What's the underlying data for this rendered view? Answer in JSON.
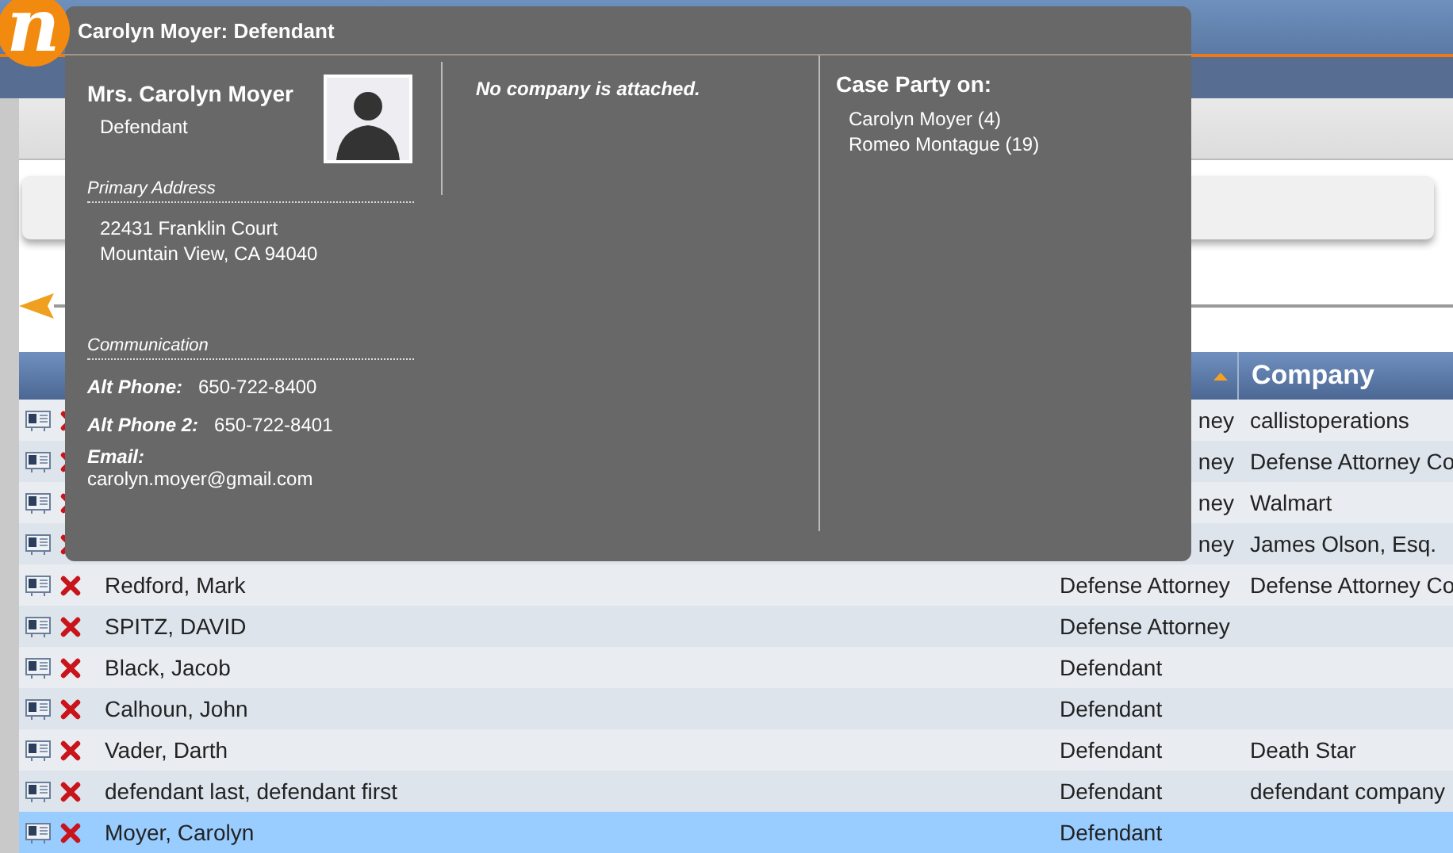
{
  "app": {
    "logo_letter": "n"
  },
  "table": {
    "type_column": {
      "sorted": true
    },
    "company_column": {
      "label": "Company"
    },
    "rows": [
      {
        "type": "ney",
        "cut": true,
        "company": "callistoperations",
        "selected": false
      },
      {
        "type": "ney",
        "cut": true,
        "company": "Defense Attorney Co",
        "selected": false
      },
      {
        "type": "ney",
        "cut": true,
        "company": "Walmart",
        "selected": false
      },
      {
        "type": "ney",
        "cut": true,
        "company": "James Olson, Esq.",
        "selected": false
      },
      {
        "name": "Redford, Mark",
        "type": "Defense Attorney",
        "cut": false,
        "company": "Defense Attorney Co",
        "selected": false
      },
      {
        "name": "SPITZ, DAVID",
        "type": "Defense Attorney",
        "cut": false,
        "selected": false
      },
      {
        "name": "Black, Jacob",
        "type": "Defendant",
        "cut": false,
        "selected": false
      },
      {
        "name": "Calhoun, John",
        "type": "Defendant",
        "cut": false,
        "selected": false
      },
      {
        "name": "Vader, Darth",
        "type": "Defendant",
        "cut": false,
        "company": "Death Star",
        "selected": false
      },
      {
        "name": "defendant last, defendant first",
        "type": "Defendant",
        "cut": false,
        "company": "defendant company",
        "selected": false
      },
      {
        "name": "Moyer, Carolyn",
        "type": "Defendant",
        "cut": false,
        "selected": true
      }
    ]
  },
  "popup": {
    "title": "Carolyn Moyer: Defendant",
    "name": "Mrs. Carolyn Moyer",
    "role": "Defendant",
    "company_note": "No company is attached.",
    "address_heading": "Primary Address",
    "address_lines": [
      "22431 Franklin Court",
      "Mountain View, CA 94040"
    ],
    "communication_heading": "Communication",
    "fields": [
      {
        "kind": "inline",
        "label": "Alt Phone:",
        "value": "650-722-8400"
      },
      {
        "kind": "inline",
        "label": "Alt Phone 2:",
        "value": "650-722-8401"
      },
      {
        "kind": "stacked",
        "label": "Email:",
        "value": "carolyn.moyer@gmail.com"
      }
    ],
    "case_party_heading": "Case Party on:",
    "case_party": [
      "Carolyn Moyer (4)",
      "Romeo Montague (19)"
    ]
  }
}
